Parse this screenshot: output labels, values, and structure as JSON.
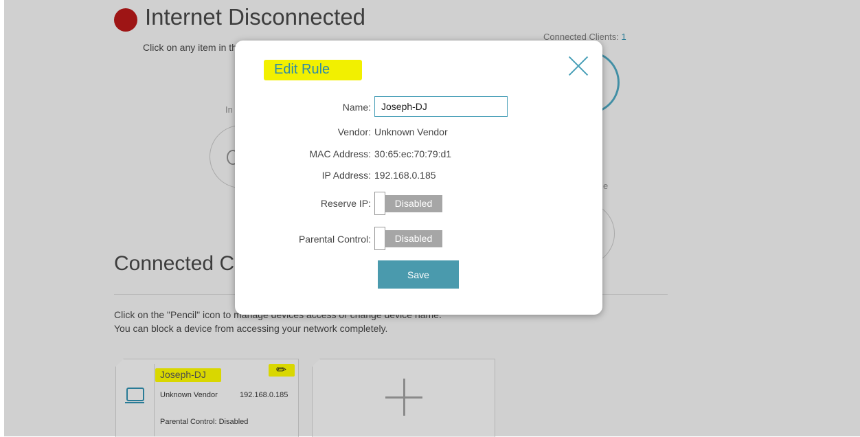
{
  "status": {
    "title": "Internet Disconnected",
    "instruction": "Click on any item in the diagram for more information.",
    "color": "#b01818"
  },
  "clients_summary": {
    "label": "Connected Clients:",
    "count": "1"
  },
  "diagram_fragments": {
    "left_label": "In",
    "right_label": "e"
  },
  "section": {
    "title": "Connected Clients",
    "desc_line1": "Click on the \"Pencil\" icon to manage devices access or change device name.",
    "desc_line2": "You can block a device from accessing your network completely."
  },
  "client_card": {
    "name": "Joseph-DJ",
    "vendor": "Unknown Vendor",
    "ip": "192.168.0.185",
    "parental": "Parental Control: Disabled",
    "icon": "laptop-icon",
    "edit_icon": "pencil-icon"
  },
  "add_card": {
    "icon": "plus-icon"
  },
  "modal": {
    "title": "Edit Rule",
    "close_icon": "close-icon",
    "fields": {
      "name_label": "Name:",
      "name_value": "Joseph-DJ",
      "vendor_label": "Vendor:",
      "vendor_value": "Unknown Vendor",
      "mac_label": "MAC Address:",
      "mac_value": "30:65:ec:70:79:d1",
      "ip_label": "IP Address:",
      "ip_value": "192.168.0.185",
      "reserve_label": "Reserve IP:",
      "reserve_state": "Disabled",
      "parental_label": "Parental Control:",
      "parental_state": "Disabled"
    },
    "save_label": "Save"
  },
  "colors": {
    "accent": "#4a9aad",
    "highlight": "#f2f000",
    "toggle_off": "#a6a6a6"
  }
}
